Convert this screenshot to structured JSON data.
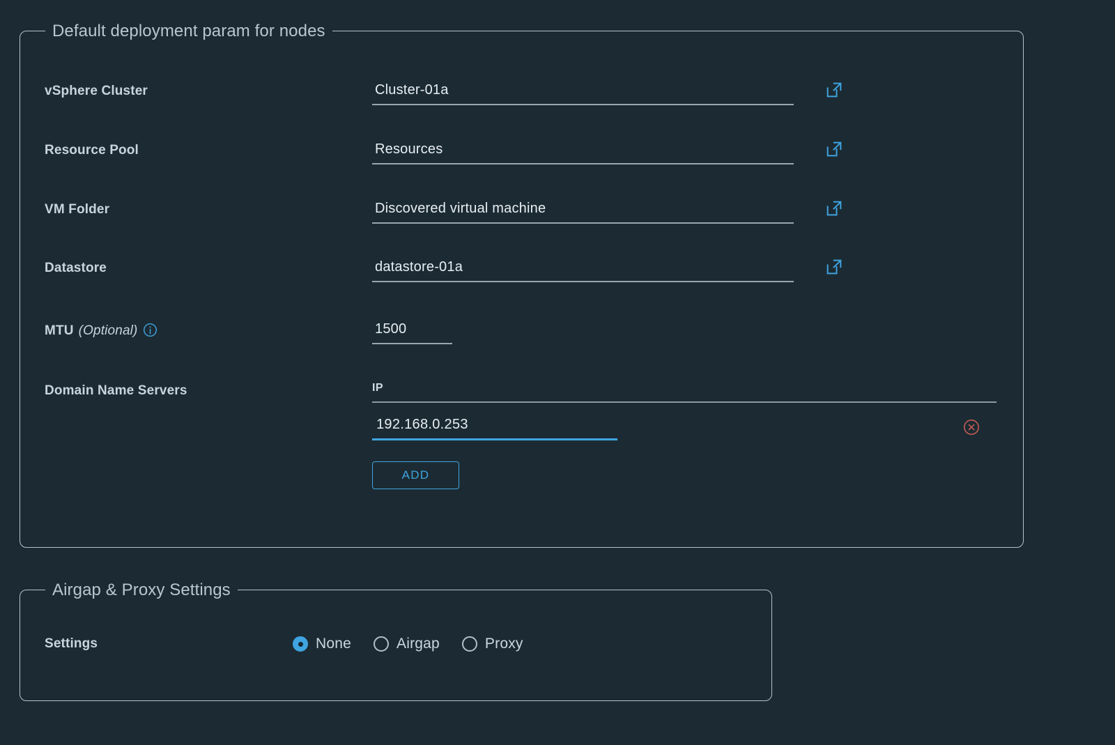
{
  "colors": {
    "background": "#1c2b33",
    "panel_border": "#b6c2cc",
    "accent": "#3fa4e0",
    "label_text": "#c9d4de",
    "input_underline": "#97a7b3",
    "danger": "#c55a54"
  },
  "deployment_panel": {
    "legend": "Default deployment param for nodes",
    "fields": [
      {
        "label": "vSphere Cluster",
        "value": "Cluster-01a",
        "placeholder": "",
        "icon": "external-link-icon"
      },
      {
        "label": "Resource Pool",
        "value": "Resources",
        "placeholder": "",
        "icon": "external-link-icon"
      },
      {
        "label": "VM Folder",
        "value": "Discovered virtual machine",
        "placeholder": "",
        "icon": "external-link-icon"
      },
      {
        "label": "Datastore",
        "value": "datastore-01a",
        "placeholder": "",
        "icon": "external-link-icon"
      }
    ],
    "mtu": {
      "label": "MTU",
      "optional_text": "(Optional)",
      "info_icon": "info-circle-icon",
      "value": "1500",
      "placeholder": ""
    },
    "dns": {
      "label": "Domain Name Servers",
      "column_header": "IP",
      "entries": [
        {
          "value": "192.168.0.253",
          "placeholder": "",
          "delete_icon": "delete-circle-icon"
        }
      ],
      "add_label": "ADD"
    }
  },
  "airgap_panel": {
    "legend": "Airgap & Proxy Settings",
    "settings_label": "Settings",
    "options": [
      {
        "label": "None",
        "selected": true
      },
      {
        "label": "Airgap",
        "selected": false
      },
      {
        "label": "Proxy",
        "selected": false
      }
    ]
  }
}
